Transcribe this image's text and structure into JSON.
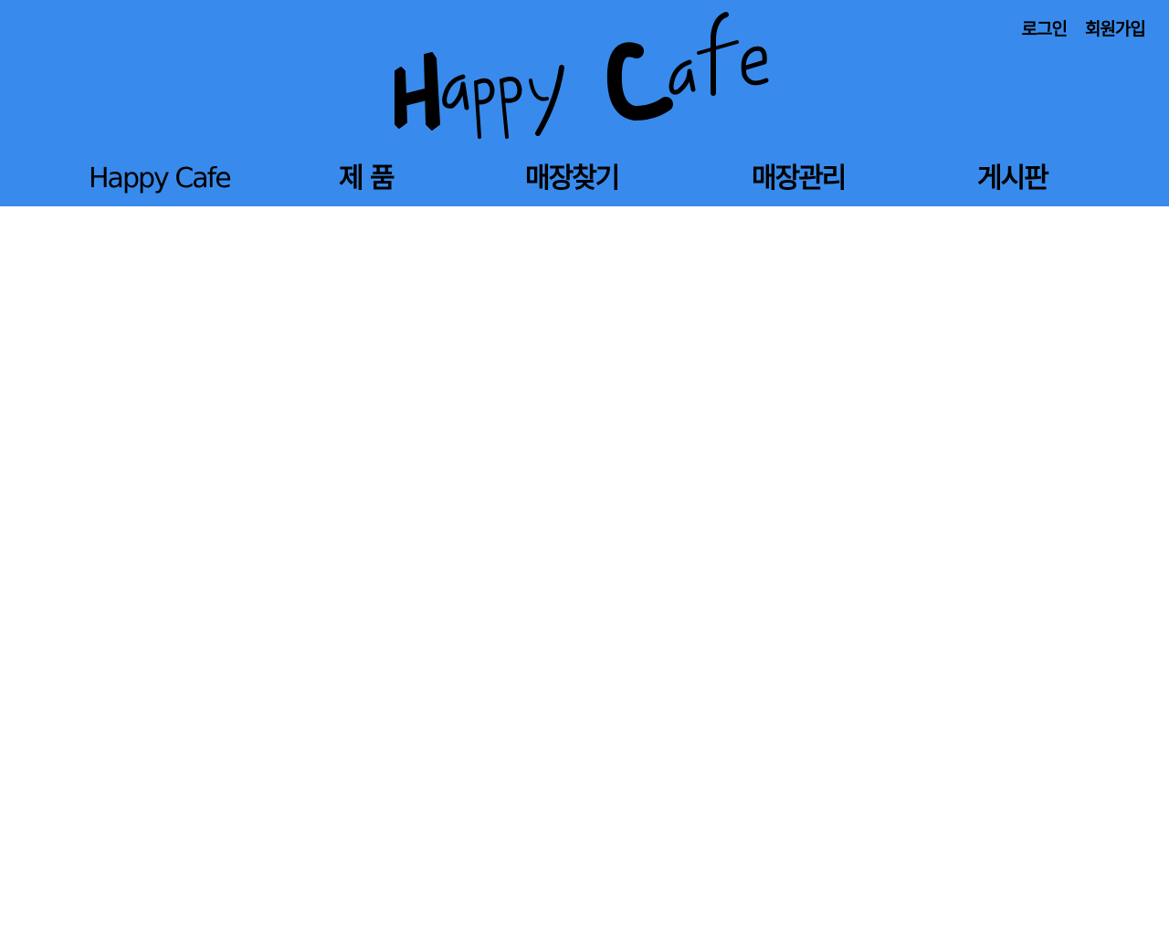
{
  "header": {
    "background_color": "#388bec",
    "logo_text": "Happy Cafe",
    "auth_links": {
      "login": "로그인",
      "signup": "회원가입"
    }
  },
  "nav": {
    "items": [
      {
        "label": "Happy Cafe"
      },
      {
        "label": "제 품"
      },
      {
        "label": "매장찾기"
      },
      {
        "label": "매장관리"
      },
      {
        "label": "게시판"
      }
    ]
  }
}
